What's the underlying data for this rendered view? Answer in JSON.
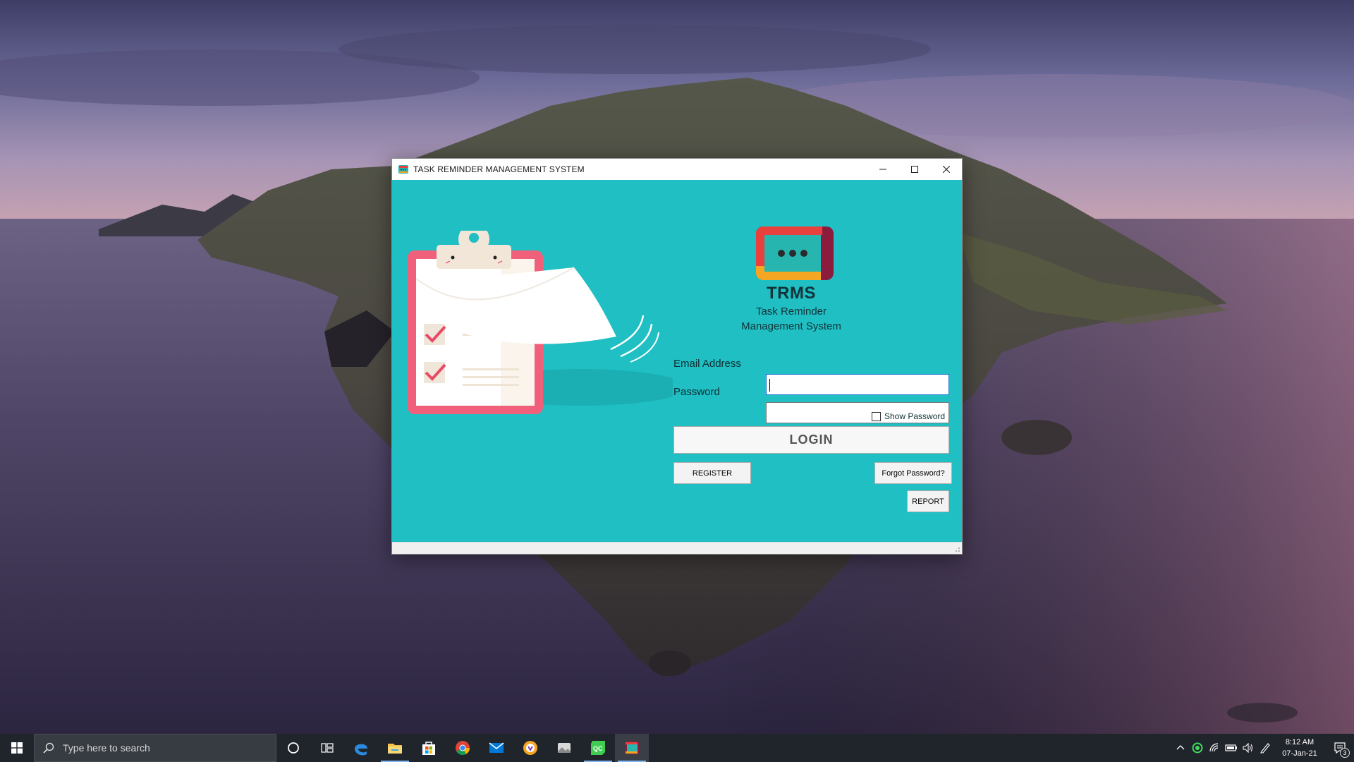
{
  "window": {
    "title": "TASK REMINDER MANAGEMENT SYSTEM",
    "controls": [
      "minimize",
      "maximize",
      "close"
    ]
  },
  "brand": {
    "name": "TRMS",
    "subtitle_line1": "Task Reminder",
    "subtitle_line2": "Management System",
    "logo_icon": "chat-bubble-dots-icon"
  },
  "form": {
    "email_label": "Email Address",
    "email_value": "",
    "password_label": "Password",
    "password_value": "",
    "show_password_label": "Show Password",
    "show_password_checked": false,
    "login_label": "LOGIN",
    "register_label": "REGISTER",
    "forgot_label": "Forgot Password?",
    "report_label": "REPORT"
  },
  "taskbar": {
    "search_placeholder": "Type here to search",
    "pinned": [
      "cortana-icon",
      "task-view-icon",
      "edge-icon",
      "file-explorer-icon",
      "store-icon",
      "chrome-icon",
      "mail-icon",
      "vpn-icon",
      "photos-icon",
      "qt-creator-icon",
      "trms-app-icon"
    ],
    "active_app": "trms-app-icon",
    "time": "8:12 AM",
    "date": "07-Jan-21",
    "notification_count": "3"
  },
  "colors": {
    "app_background": "#1fbfc3",
    "taskbar": "#20242b",
    "clipboard_pink": "#f0607a",
    "logo_red": "#e8403c",
    "logo_orange": "#f5a623",
    "logo_maroon": "#8c1c3e",
    "logo_teal": "#27b5b0"
  }
}
